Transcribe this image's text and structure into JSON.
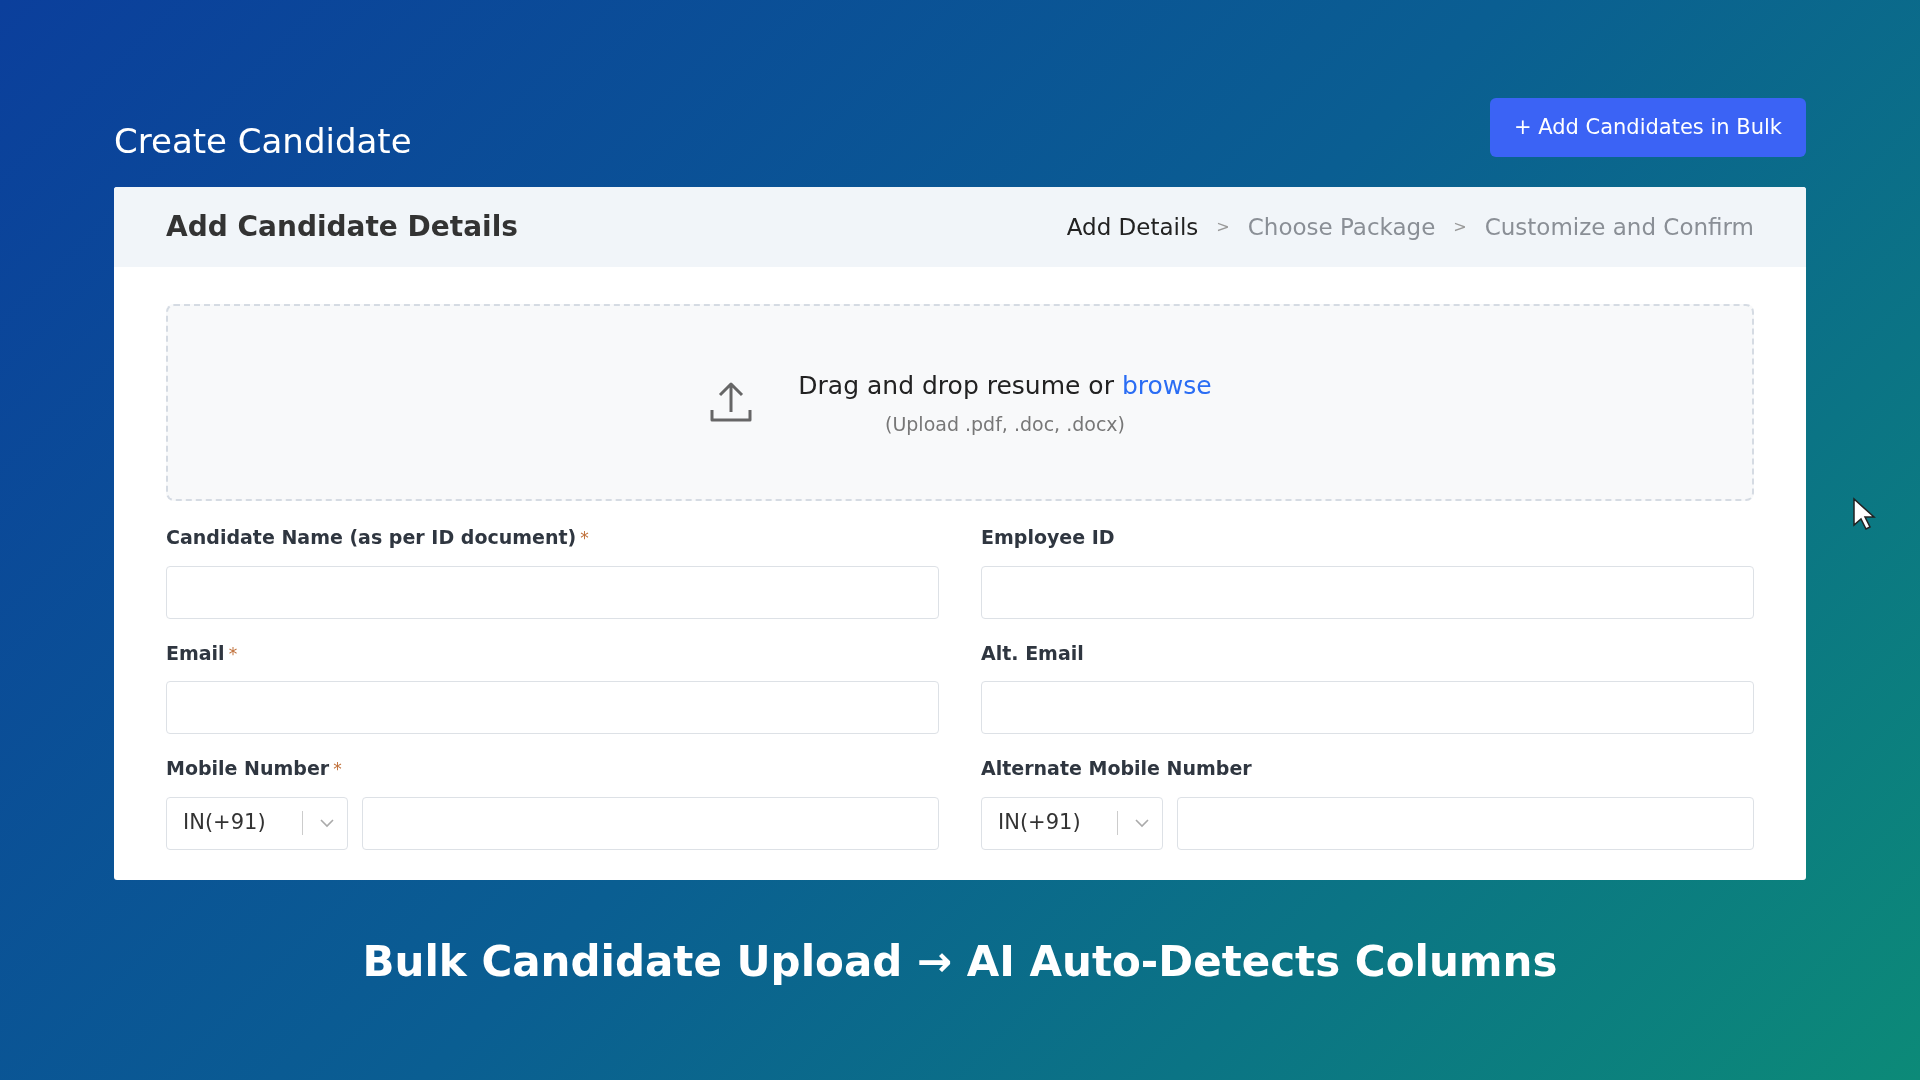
{
  "page_title": "Create Candidate",
  "bulk_button": "+ Add Candidates in Bulk",
  "card": {
    "title": "Add Candidate Details",
    "steps": [
      {
        "label": "Add Details",
        "selected": true
      },
      {
        "label": "Choose Package",
        "selected": false
      },
      {
        "label": "Customize and Confirm",
        "selected": false
      }
    ],
    "step_separator": ">",
    "upload": {
      "text": "Drag and drop resume or",
      "link": "browse",
      "hint": "(Upload .pdf, .doc, .docx)"
    },
    "fields": [
      {
        "label": "Candidate Name (as per ID document)",
        "required": true,
        "kind": "text"
      },
      {
        "label": "Employee ID",
        "required": false,
        "kind": "text"
      },
      {
        "label": "Email",
        "required": true,
        "kind": "text"
      },
      {
        "label": "Alt. Email",
        "required": false,
        "kind": "text"
      },
      {
        "label": "Mobile Number",
        "required": true,
        "kind": "phone",
        "country": "IN(+91)"
      },
      {
        "label": "Alternate Mobile Number",
        "required": false,
        "kind": "phone",
        "country": "IN(+91)"
      }
    ],
    "required_mark": "*"
  },
  "caption": "Bulk Candidate Upload → AI Auto-Detects Columns"
}
